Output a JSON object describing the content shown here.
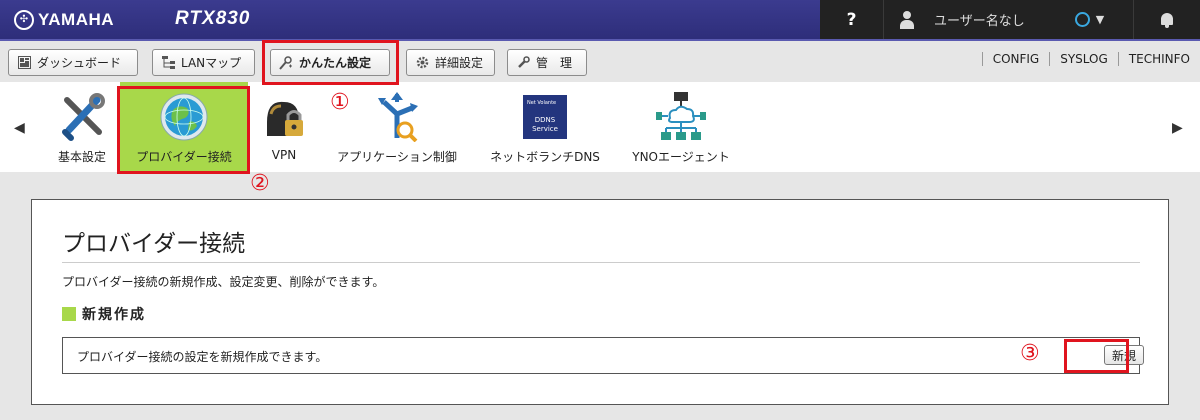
{
  "header": {
    "brand": "YAMAHA",
    "model": "RTX830",
    "help": "?",
    "user": "ユーザー名なし"
  },
  "nav": {
    "tabs": [
      {
        "label": "ダッシュボード",
        "icon": "dashboard-icon"
      },
      {
        "label": "LANマップ",
        "icon": "lan-map-icon"
      },
      {
        "label": "かんたん設定",
        "icon": "wand-icon"
      },
      {
        "label": "詳細設定",
        "icon": "gear-icon"
      },
      {
        "label": "管　理",
        "icon": "wrench-icon"
      }
    ],
    "links": [
      "CONFIG",
      "SYSLOG",
      "TECHINFO"
    ]
  },
  "toolbar": {
    "items": [
      {
        "label": "基本設定",
        "icon": "tools-icon"
      },
      {
        "label": "プロバイダー接続",
        "icon": "globe-icon"
      },
      {
        "label": "VPN",
        "icon": "lock-icon"
      },
      {
        "label": "アプリケーション制御",
        "icon": "app-control-icon"
      },
      {
        "label": "ネットボランチDNS",
        "icon": "ddns-icon"
      },
      {
        "label": "YNOエージェント",
        "icon": "network-icon"
      }
    ],
    "ddns_icon_text": [
      "Net Volante",
      "DDNS",
      "Service"
    ]
  },
  "panel": {
    "title": "プロバイダー接続",
    "description": "プロバイダー接続の新規作成、設定変更、削除ができます。",
    "section": "新規作成",
    "row_text": "プロバイダー接続の設定を新規作成できます。",
    "new_button": "新規"
  },
  "annotations": [
    "①",
    "②",
    "③"
  ],
  "colors": {
    "header": "#2e2e7a",
    "selected": "#a8d84a",
    "highlight": "#e0141e"
  }
}
